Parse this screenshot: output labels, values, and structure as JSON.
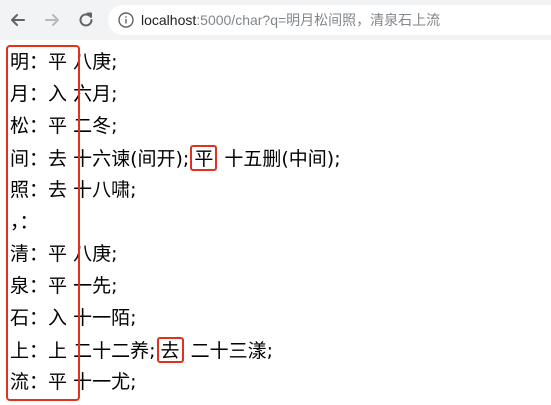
{
  "browser": {
    "url_host": "localhost",
    "url_path": ":5000/char?q=明月松间照，清泉石上流"
  },
  "rows": [
    {
      "char": "明",
      "sep": "：",
      "tone": "平",
      "text": "八庚;"
    },
    {
      "char": "月",
      "sep": "：",
      "tone": "入",
      "text": "六月;"
    },
    {
      "char": "松",
      "sep": "：",
      "tone": "平",
      "text": "二冬;"
    },
    {
      "char": "间",
      "sep": "：",
      "tone": "去",
      "text": "十六谏(间开);",
      "hl": "平",
      "text2": "十五删(中间);"
    },
    {
      "char": "照",
      "sep": "：",
      "tone": "去",
      "text": "十八啸;"
    },
    {
      "char": "，",
      "sep": "：",
      "tone": "",
      "text": ""
    },
    {
      "char": "清",
      "sep": "：",
      "tone": "平",
      "text": "八庚;"
    },
    {
      "char": "泉",
      "sep": "：",
      "tone": "平",
      "text": "一先;"
    },
    {
      "char": "石",
      "sep": "：",
      "tone": "入",
      "text": "十一陌;"
    },
    {
      "char": "上",
      "sep": "：",
      "tone": "上",
      "text": "二十二养;",
      "hl": "去",
      "text2": "二十三漾;"
    },
    {
      "char": "流",
      "sep": "：",
      "tone": "平",
      "text": "十一尤;"
    }
  ]
}
